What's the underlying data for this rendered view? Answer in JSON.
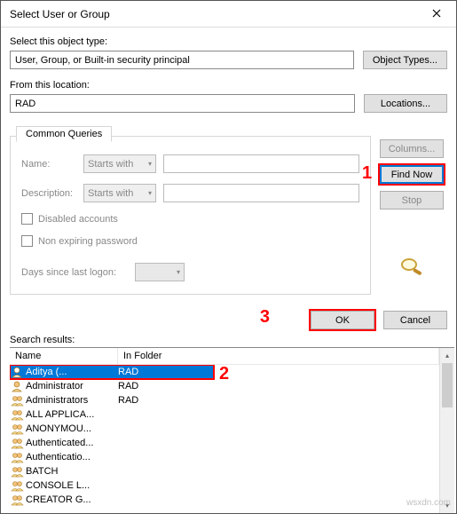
{
  "titlebar": {
    "title": "Select User or Group"
  },
  "object_type": {
    "label": "Select this object type:",
    "value": "User, Group, or Built-in security principal",
    "button": "Object Types..."
  },
  "location": {
    "label": "From this location:",
    "value": "RAD",
    "button": "Locations..."
  },
  "queries": {
    "tab": "Common Queries",
    "name_label": "Name:",
    "name_mode": "Starts with",
    "desc_label": "Description:",
    "desc_mode": "Starts with",
    "disabled_label": "Disabled accounts",
    "nonexp_label": "Non expiring password",
    "days_label": "Days since last logon:",
    "columns_btn": "Columns...",
    "find_btn": "Find Now",
    "stop_btn": "Stop"
  },
  "actions": {
    "ok": "OK",
    "cancel": "Cancel"
  },
  "results": {
    "label": "Search results:",
    "col_name": "Name",
    "col_folder": "In Folder",
    "rows": [
      {
        "name": "Aditya       (...",
        "folder": "RAD",
        "icon": "user",
        "selected": true
      },
      {
        "name": "Administrator",
        "folder": "RAD",
        "icon": "user"
      },
      {
        "name": "Administrators",
        "folder": "RAD",
        "icon": "group"
      },
      {
        "name": "ALL APPLICA...",
        "folder": "",
        "icon": "group"
      },
      {
        "name": "ANONYMOU...",
        "folder": "",
        "icon": "group"
      },
      {
        "name": "Authenticated...",
        "folder": "",
        "icon": "group"
      },
      {
        "name": "Authenticatio...",
        "folder": "",
        "icon": "group"
      },
      {
        "name": "BATCH",
        "folder": "",
        "icon": "group"
      },
      {
        "name": "CONSOLE L...",
        "folder": "",
        "icon": "group"
      },
      {
        "name": "CREATOR G...",
        "folder": "",
        "icon": "group"
      }
    ]
  },
  "annotations": {
    "a1": "1",
    "a2": "2",
    "a3": "3"
  },
  "watermark": "wsxdn.com"
}
